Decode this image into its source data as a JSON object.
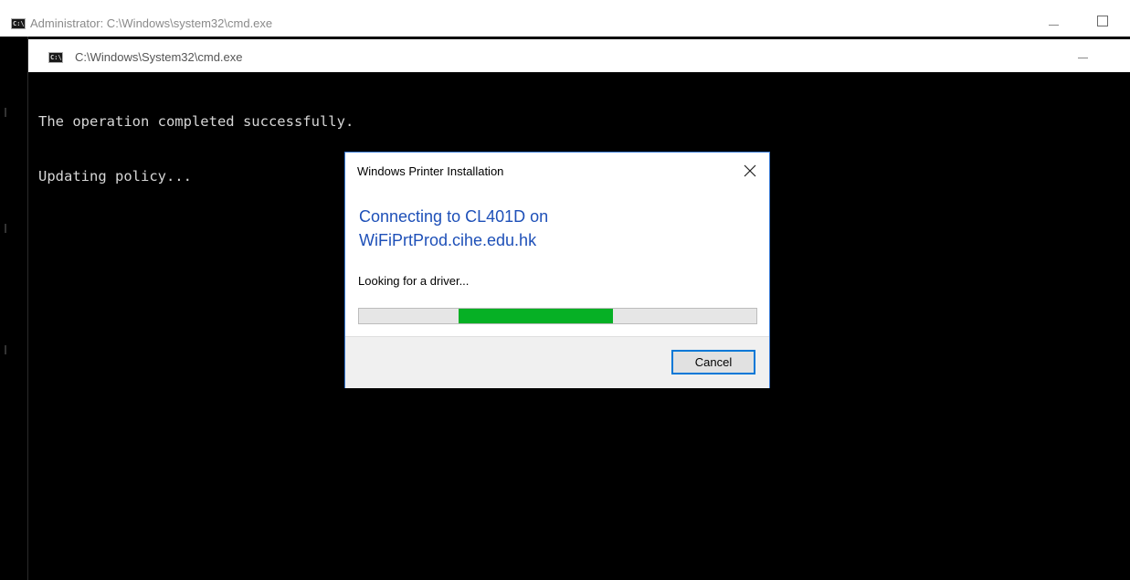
{
  "outer_window": {
    "title": "Administrator: C:\\Windows\\system32\\cmd.exe",
    "icon": "cmd-icon",
    "icon_label": "C:\\.",
    "buttons": [
      "minimize-icon",
      "maximize-icon"
    ]
  },
  "inner_window": {
    "title": "C:\\Windows\\System32\\cmd.exe",
    "icon": "cmd-icon",
    "icon_label": "C:\\."
  },
  "console": {
    "lines": [
      "The operation completed successfully.",
      "Updating policy..."
    ]
  },
  "dialog": {
    "title": "Windows Printer Installation",
    "heading_line1": "Connecting to CL401D on",
    "heading_line2": "WiFiPrtProd.cihe.edu.hk",
    "status": "Looking for a driver...",
    "progress": {
      "indeterminate": true,
      "segment_start_fraction": 0.25,
      "segment_end_fraction": 0.64
    },
    "cancel_label": "Cancel"
  },
  "colors": {
    "console_background": "#000000",
    "console_text": "#d6d6d6",
    "dialog_border": "#3a7bd5",
    "heading_blue": "#1e50b8",
    "progress_green": "#06b025",
    "button_focus": "#0078d7"
  }
}
